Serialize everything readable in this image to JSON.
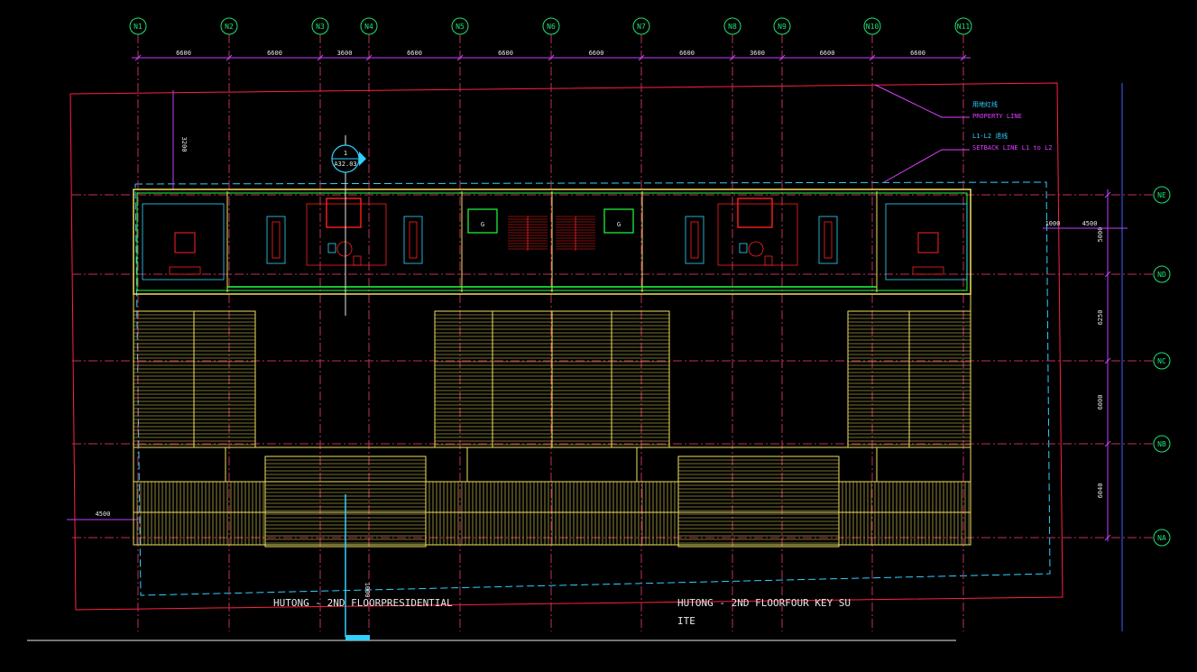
{
  "colors": {
    "background": "#000000",
    "grid": "#c0305a",
    "grid_bubble": "#20e070",
    "dimension": "#c040ff",
    "property_line": "#ff2040",
    "setback_line": "#30d0ff",
    "building": "#f0e060",
    "wall": "#20ff40",
    "interior": "#30d8ff",
    "furniture_red": "#ff2020",
    "text_white": "#e8e8e8",
    "label_magenta": "#e040ff"
  },
  "grid_top": [
    "N1",
    "N2",
    "N3",
    "N4",
    "N5",
    "N6",
    "N7",
    "N8",
    "N9",
    "N10",
    "N11"
  ],
  "grid_right": [
    "NE",
    "ND",
    "NC",
    "NB",
    "NA"
  ],
  "dims_top": [
    "6600",
    "6600",
    "3600",
    "6600",
    "6600",
    "6600",
    "6600",
    "3600",
    "6600",
    "6600"
  ],
  "dims_right": [
    "5000",
    "6250",
    "6000",
    "6040"
  ],
  "dims_misc": {
    "top_left_vertical": "3200",
    "right_offset_a": "1000",
    "right_offset_b": "4500",
    "left_offset": "4500",
    "bottom_small": "1000"
  },
  "section_marker": {
    "number": "1",
    "sheet": "A32.03"
  },
  "notes": {
    "property_line_cn": "用地红线",
    "property_line": "PROPERTY LINE",
    "setback_cn": "L1-L2 退线",
    "setback": "SETBACK LINE L1 to L2"
  },
  "stair_labels": [
    "G",
    "G"
  ],
  "titles": {
    "left": "HUTONG - 2ND FLOORPRESIDENTIAL",
    "right_line1": "HUTONG - 2ND FLOORFOUR KEY SU",
    "right_line2": "ITE"
  }
}
